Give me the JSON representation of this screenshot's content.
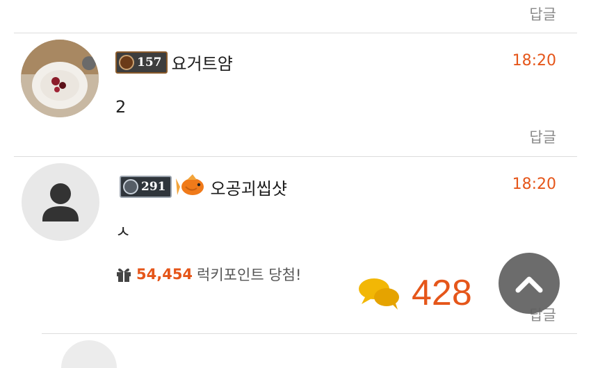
{
  "reply_label": "답글",
  "comments": [
    {
      "level": "157",
      "nickname": "요거트얌",
      "time": "18:20",
      "body": "2",
      "avatar": "food-photo"
    },
    {
      "level": "291",
      "nickname": "오공괴씹샷",
      "time": "18:20",
      "body": "ㅅ",
      "avatar": "default-user",
      "lucky": {
        "amount": "54,454",
        "text": "럭키포인트 당첨!"
      }
    }
  ],
  "floating": {
    "comment_count": "428",
    "icon": "speech-bubbles-icon"
  },
  "colors": {
    "accent": "#e5561a",
    "reply": "#8a8a8a",
    "bubble": "#f2b705"
  }
}
